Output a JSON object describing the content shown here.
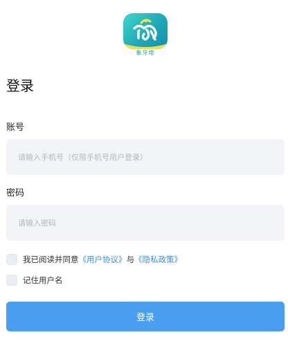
{
  "logo": {
    "name": "elephant-logo-icon",
    "caption": "象牙塔",
    "colors": [
      "#3fd6c9",
      "#148fae",
      "#f6e44a"
    ]
  },
  "page_title": "登录",
  "account": {
    "label": "账号",
    "placeholder": "请输入手机号（仅限手机号用户登录）",
    "value": ""
  },
  "password": {
    "label": "密码",
    "placeholder": "请输入密码",
    "value": ""
  },
  "agreement": {
    "checked": false,
    "prefix": "我已阅读并同意",
    "user_agreement": "《用户协议》",
    "conjunction": "与",
    "privacy_policy": "《隐私政策》"
  },
  "remember": {
    "checked": false,
    "label": "记住用户名"
  },
  "login_button": {
    "label": "登录"
  },
  "colors": {
    "accent": "#4a9ef0",
    "link": "#3c8dde",
    "input_bg": "#f2f4f7"
  }
}
